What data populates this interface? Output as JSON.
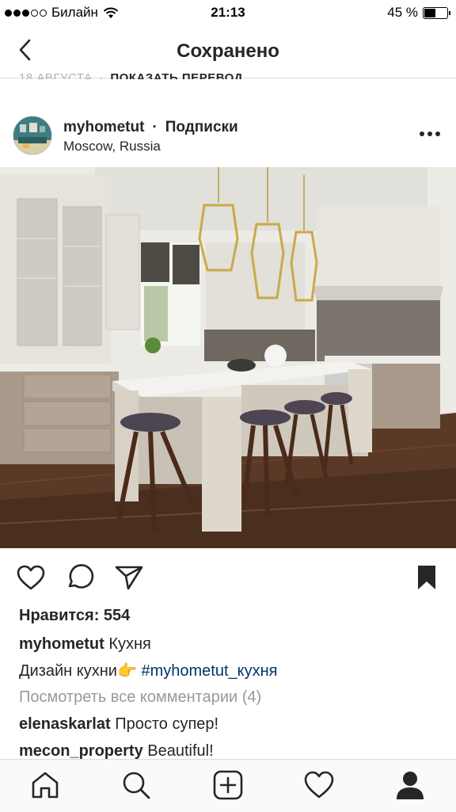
{
  "status_bar": {
    "carrier": "Билайн",
    "time": "21:13",
    "battery": "45 %",
    "battery_level": 0.45
  },
  "header": {
    "title": "Сохранено",
    "back_icon": "chevron-left-icon"
  },
  "previous_post_meta": {
    "date": "18 АВГУСТА",
    "separator": "·",
    "translate": "ПОКАЗАТЬ ПЕРЕВОД"
  },
  "post": {
    "username": "myhometut",
    "separator": "·",
    "follow_status": "Подписки",
    "location": "Moscow, Russia",
    "more_icon": "more-horizontal-icon",
    "likes": "Нравится: 554",
    "caption": {
      "username": "myhometut",
      "text": "Кухня",
      "line2_text": "Дизайн кухни",
      "emoji": "👉",
      "hashtag": "#myhometut_кухня"
    },
    "view_comments": "Посмотреть все комментарии (4)",
    "comments": [
      {
        "username": "elenaskarlat",
        "text": "Просто супер!"
      },
      {
        "username": "mecon_property",
        "text": "Beautiful!"
      }
    ]
  },
  "actions": {
    "like_icon": "heart-icon",
    "comment_icon": "comment-icon",
    "share_icon": "send-icon",
    "save_icon": "bookmark-icon"
  },
  "tab_bar": {
    "items": [
      "home-icon",
      "search-icon",
      "add-icon",
      "activity-heart-icon",
      "profile-icon"
    ]
  },
  "colors": {
    "text": "#262626",
    "muted": "#999999",
    "hashtag": "#003569",
    "divider": "#dbdbdb"
  }
}
